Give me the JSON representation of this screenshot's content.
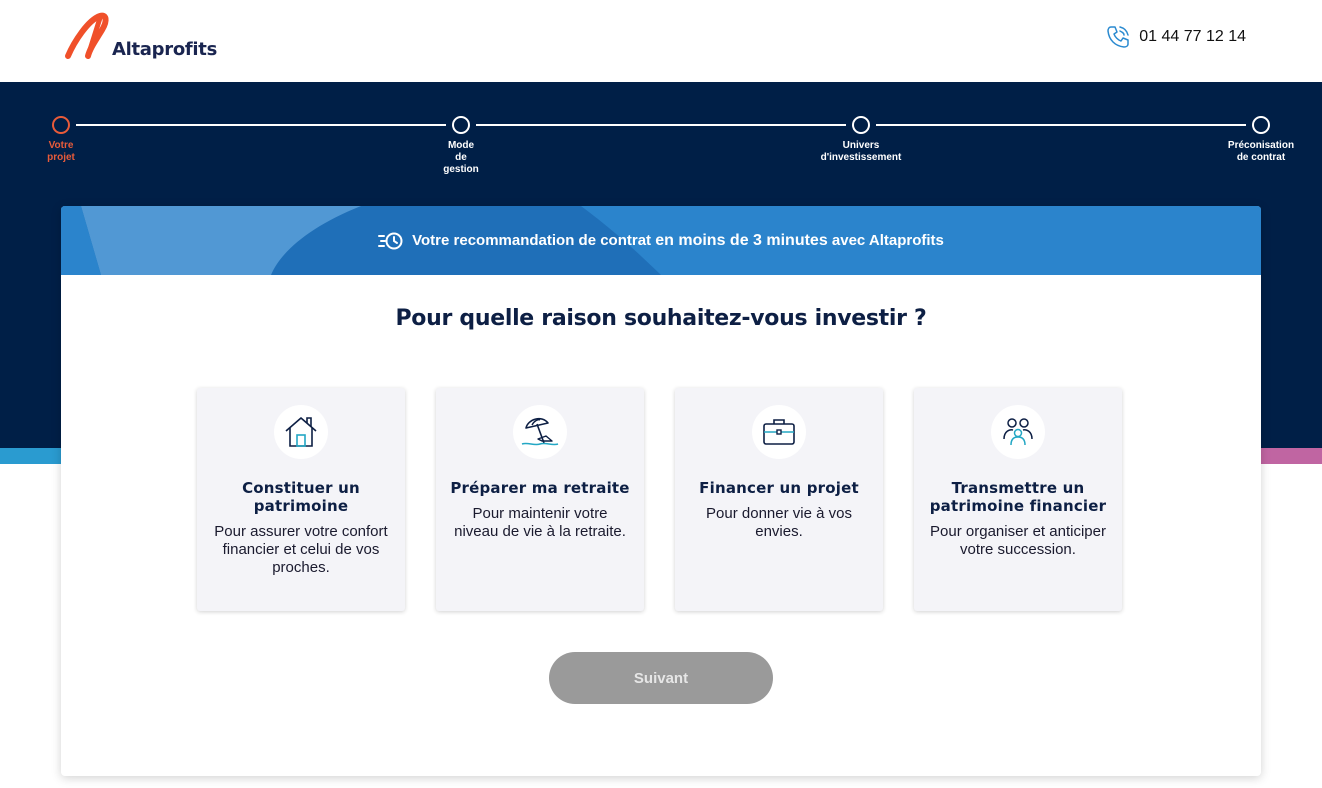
{
  "brand": {
    "name": "Altaprofits",
    "accent": "#f0502a",
    "navy": "#001f47"
  },
  "header": {
    "phone": "01 44 77 12 14"
  },
  "stepper": {
    "steps": [
      {
        "label_lines": [
          "Votre",
          "projet"
        ],
        "active": true
      },
      {
        "label_lines": [
          "Mode",
          "de",
          "gestion"
        ],
        "active": false
      },
      {
        "label_lines": [
          "Univers",
          "d'investissement"
        ],
        "active": false
      },
      {
        "label_lines": [
          "Préconisation",
          "de contrat"
        ],
        "active": false
      }
    ]
  },
  "banner": {
    "text_part1": "Votre recommandation de contrat",
    "text_bold": "en moins de 3 minutes",
    "text_part2": "avec Altaprofits"
  },
  "question": "Pour quelle raison souhaitez-vous investir ?",
  "options": [
    {
      "icon": "house-icon",
      "title": "Constituer un patrimoine",
      "description": "Pour assurer votre confort financier et celui de vos proches."
    },
    {
      "icon": "beach-umbrella-icon",
      "title": "Préparer ma retraite",
      "description": "Pour maintenir votre niveau de vie à la retraite."
    },
    {
      "icon": "briefcase-icon",
      "title": "Financer un projet",
      "description": "Pour donner vie à vos envies."
    },
    {
      "icon": "family-icon",
      "title": "Transmettre un patrimoine financier",
      "description": "Pour organiser et anticiper votre succession."
    }
  ],
  "next_button": {
    "label": "Suivant",
    "disabled": true
  }
}
